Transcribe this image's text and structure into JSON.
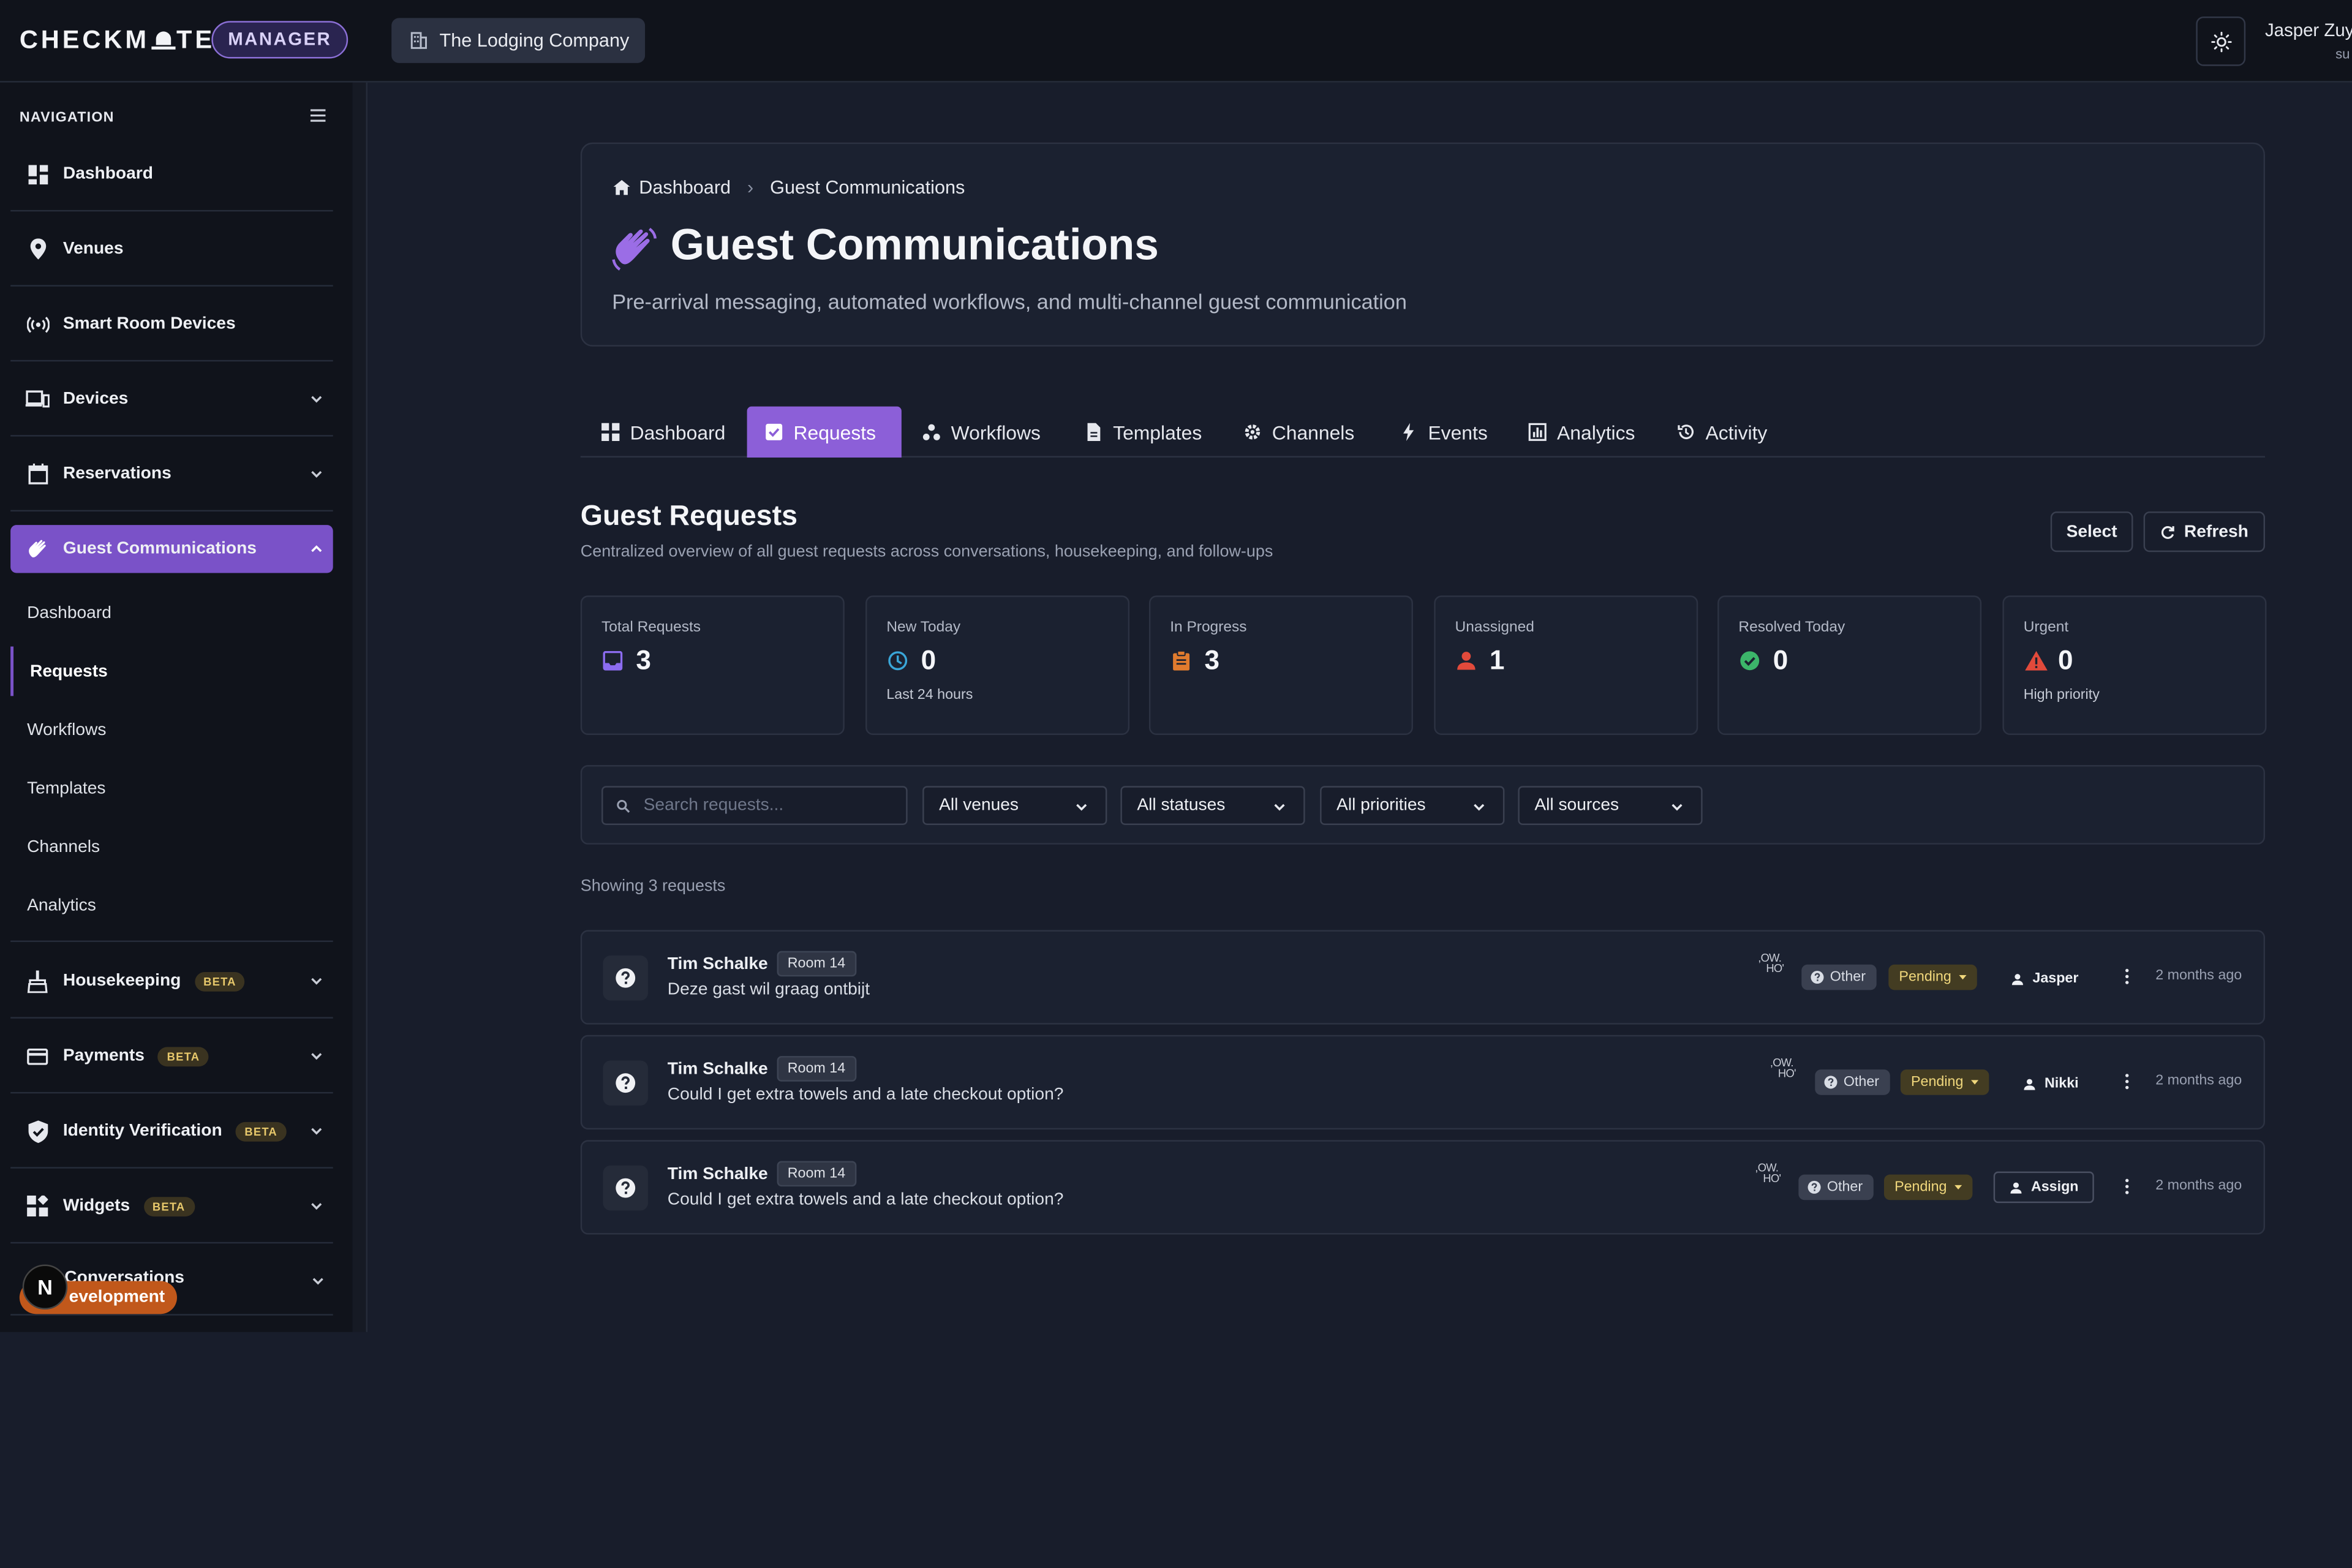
{
  "header": {
    "brand_left": "CHECKM",
    "brand_right": "TE",
    "badge": "MANAGER",
    "company": "The Lodging Company",
    "user_name": "Jasper Zuy",
    "user_role": "su"
  },
  "sidebar": {
    "title": "NAVIGATION",
    "items": [
      {
        "label": "Dashboard",
        "icon": "grid-icon"
      },
      {
        "label": "Venues",
        "icon": "map-pin-icon"
      },
      {
        "label": "Smart Room Devices",
        "icon": "broadcast-icon"
      },
      {
        "label": "Devices",
        "icon": "devices-icon"
      },
      {
        "label": "Reservations",
        "icon": "calendar-icon"
      },
      {
        "label": "Guest Communications",
        "icon": "waving-hand-icon"
      },
      {
        "label": "Housekeeping",
        "icon": "broom-icon",
        "badge": "BETA"
      },
      {
        "label": "Payments",
        "icon": "credit-card-icon",
        "badge": "BETA"
      },
      {
        "label": "Identity Verification",
        "icon": "shield-check-icon",
        "badge": "BETA"
      },
      {
        "label": "Widgets",
        "icon": "widgets-icon",
        "badge": "BETA"
      },
      {
        "label": "Conversations",
        "icon": "chat-icon"
      }
    ],
    "sub_items": [
      "Dashboard",
      "Requests",
      "Workflows",
      "Templates",
      "Channels",
      "Analytics"
    ],
    "dev_badge": "Development",
    "dev_badge_visible": "evelopment",
    "dev_logo": "N"
  },
  "hero": {
    "crumb_home": "Dashboard",
    "crumb_current": "Guest Communications",
    "title": "Guest Communications",
    "subtitle": "Pre-arrival messaging, automated workflows, and multi-channel guest communication"
  },
  "tabs": [
    "Dashboard",
    "Requests",
    "Workflows",
    "Templates",
    "Channels",
    "Events",
    "Analytics",
    "Activity"
  ],
  "section": {
    "title": "Guest Requests",
    "subtitle": "Centralized overview of all guest requests across conversations, housekeeping, and follow-ups",
    "select_label": "Select",
    "refresh_label": "Refresh"
  },
  "stats": [
    {
      "label": "Total Requests",
      "value": "3",
      "note": "",
      "icon": "inbox-icon",
      "color": "#8c6cf0"
    },
    {
      "label": "New Today",
      "value": "0",
      "note": "Last 24 hours",
      "icon": "clock-icon",
      "color": "#3aa6d8"
    },
    {
      "label": "In Progress",
      "value": "3",
      "note": "",
      "icon": "clipboard-icon",
      "color": "#e07b2e"
    },
    {
      "label": "Unassigned",
      "value": "1",
      "note": "",
      "icon": "person-icon",
      "color": "#e24a3b"
    },
    {
      "label": "Resolved Today",
      "value": "0",
      "note": "",
      "icon": "check-circle-icon",
      "color": "#3cb56a"
    },
    {
      "label": "Urgent",
      "value": "0",
      "note": "High priority",
      "icon": "warning-icon",
      "color": "#e24a3b"
    }
  ],
  "filters": {
    "search_placeholder": "Search requests...",
    "venue": "All venues",
    "status": "All statuses",
    "priority": "All priorities",
    "source": "All sources"
  },
  "showing": "Showing 3 requests",
  "requests": [
    {
      "name": "Tim Schalke",
      "room": "Room 14",
      "message": "Deze gast wil graag ontbijt",
      "source": "OW HO",
      "category": "Other",
      "status": "Pending",
      "assignee": "Jasper",
      "time": "2 months ago"
    },
    {
      "name": "Tim Schalke",
      "room": "Room 14",
      "message": "Could I get extra towels and a late checkout option?",
      "source": "OW HO",
      "category": "Other",
      "status": "Pending",
      "assignee": "Nikki",
      "time": "2 months ago"
    },
    {
      "name": "Tim Schalke",
      "room": "Room 14",
      "message": "Could I get extra towels and a late checkout option?",
      "source": "OW HO",
      "category": "Other",
      "status": "Pending",
      "assignee": "Assign",
      "time": "2 months ago"
    }
  ]
}
